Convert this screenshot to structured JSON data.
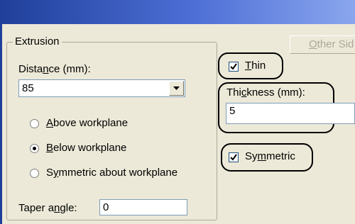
{
  "window": {
    "title": ""
  },
  "extrusion": {
    "group_label": "Extrusion",
    "distance_label_pre": "Dista",
    "distance_label_ul": "n",
    "distance_label_post": "ce (mm):",
    "distance_value": "85",
    "radios": [
      {
        "pre": "",
        "ul": "A",
        "post": "bove workplane",
        "selected": false
      },
      {
        "pre": "",
        "ul": "B",
        "post": "elow workplane",
        "selected": true
      },
      {
        "pre": "S",
        "ul": "y",
        "post": "mmetric about workplane",
        "selected": false
      }
    ],
    "taper_label_pre": "Taper a",
    "taper_label_ul": "n",
    "taper_label_post": "gle:",
    "taper_value": "0"
  },
  "other_side_button": {
    "ul": "O",
    "post": "ther Sid"
  },
  "thin": {
    "ul": "T",
    "post": "hin",
    "checked": true
  },
  "thickness": {
    "label_pre": "Thi",
    "label_ul": "c",
    "label_post": "kness (mm):",
    "value": "5"
  },
  "symmetric": {
    "pre": "Sy",
    "ul": "m",
    "post": "metric",
    "checked": true
  }
}
